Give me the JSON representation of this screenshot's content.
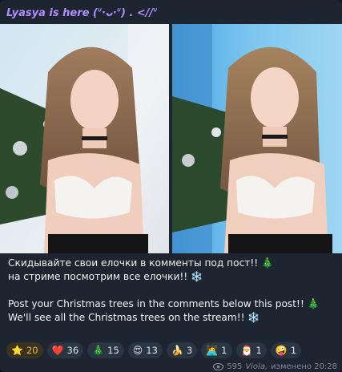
{
  "post": {
    "author": "Lyasya is here (ᐡ·ᴗ·ᐡ) . <//ᐡ",
    "caption": {
      "line1": "Скидывайте свои елочки в комменты под пост!! 🎄",
      "line2": "на стриме посмотрим все елочки!! ❄️",
      "line3": "Post your Christmas trees in the comments below this post!! 🎄",
      "line4": "We'll see all the Christmas trees on the stream!! ❄️"
    },
    "reactions": [
      {
        "icon": "⭐",
        "count": "20",
        "name": "star-icon"
      },
      {
        "icon": "❤️",
        "count": "36",
        "name": "heart-icon"
      },
      {
        "icon": "🎄",
        "count": "15",
        "name": "christmas-tree-icon"
      },
      {
        "icon": "😍",
        "count": "13",
        "name": "heart-eyes-icon"
      },
      {
        "icon": "🍌",
        "count": "3",
        "name": "banana-icon"
      },
      {
        "icon": "🧑‍💻",
        "count": "1",
        "name": "technologist-icon"
      },
      {
        "icon": "🎅",
        "count": "1",
        "name": "santa-icon"
      },
      {
        "icon": "🤪",
        "count": "1",
        "name": "zany-face-icon"
      }
    ],
    "meta": {
      "views": "595",
      "signature": "Viola,",
      "edited_time": "изменено 20:28"
    }
  }
}
